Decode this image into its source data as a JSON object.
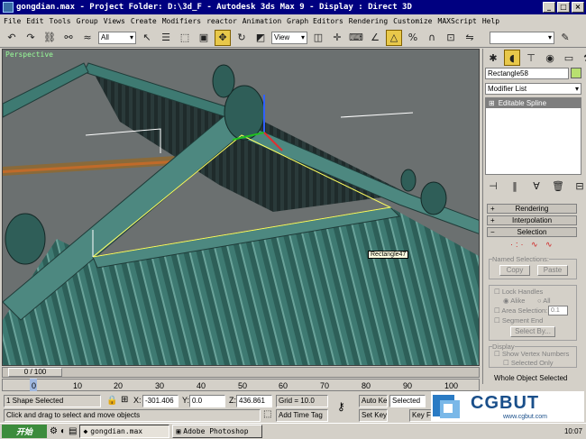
{
  "title": {
    "text": "gongdian.max   - Project Folder: D:\\3d_F    - Autodesk 3ds Max 9      - Display : Direct 3D"
  },
  "window_buttons": [
    "_",
    "□",
    "×"
  ],
  "menu": [
    "File",
    "Edit",
    "Tools",
    "Group",
    "Views",
    "Create",
    "Modifiers",
    "reactor",
    "Animation",
    "Graph Editors",
    "Rendering",
    "Customize",
    "MAXScript",
    "Help"
  ],
  "toolbar": {
    "selection_filter": "All",
    "view_mode": "View"
  },
  "viewport": {
    "label": "Perspective",
    "tooltip": "Rectangle47"
  },
  "panel": {
    "object_name": "Rectangle58",
    "modifier_list": "Modifier List",
    "stack_item": "Editable Spline",
    "rollouts": {
      "rendering": "Rendering",
      "interpolation": "Interpolation",
      "selection": "Selection"
    },
    "named_selections": "Named Selections:",
    "copy": "Copy",
    "paste": "Paste",
    "lock_handles": "Lock Handles",
    "alike": "Alike",
    "all": "All",
    "area_selection": "Area Selection:",
    "area_value": "0.1",
    "segment_end": "Segment End",
    "select_by": "Select By...",
    "display": "Display",
    "show_vertex_numbers": "Show Vertex Numbers",
    "selected_only": "Selected Only",
    "whole_object": "Whole Object Selected"
  },
  "timeline": {
    "frame": "0 / 100",
    "ticks": [
      "0",
      "10",
      "20",
      "30",
      "40",
      "50",
      "60",
      "70",
      "80",
      "90",
      "100"
    ]
  },
  "status": {
    "selected": "1 Shape Selected",
    "prompt": "Click and drag to select and move objects",
    "x_label": "X:",
    "x": "-301.406",
    "y_label": "Y:",
    "y": "0.0",
    "z_label": "Z:",
    "z": "436.861",
    "grid": "Grid = 10.0",
    "add_time_tag": "Add Time Tag",
    "auto_key": "Auto Key",
    "set_key": "Set Key",
    "selected_dropdown": "Selected",
    "key_filters": "Key Filters..."
  },
  "taskbar": {
    "start": "开始",
    "items": [
      "gongdian.max",
      "Adobe Photoshop"
    ],
    "clock": "10:07"
  },
  "watermark": {
    "brand": "CGBUT",
    "site": "www.cgbut.com"
  },
  "colors": {
    "title": "#000080",
    "active_tool": "#e8c84a",
    "viewport_bg": "#6b7070",
    "roof": "#3e7a72"
  }
}
